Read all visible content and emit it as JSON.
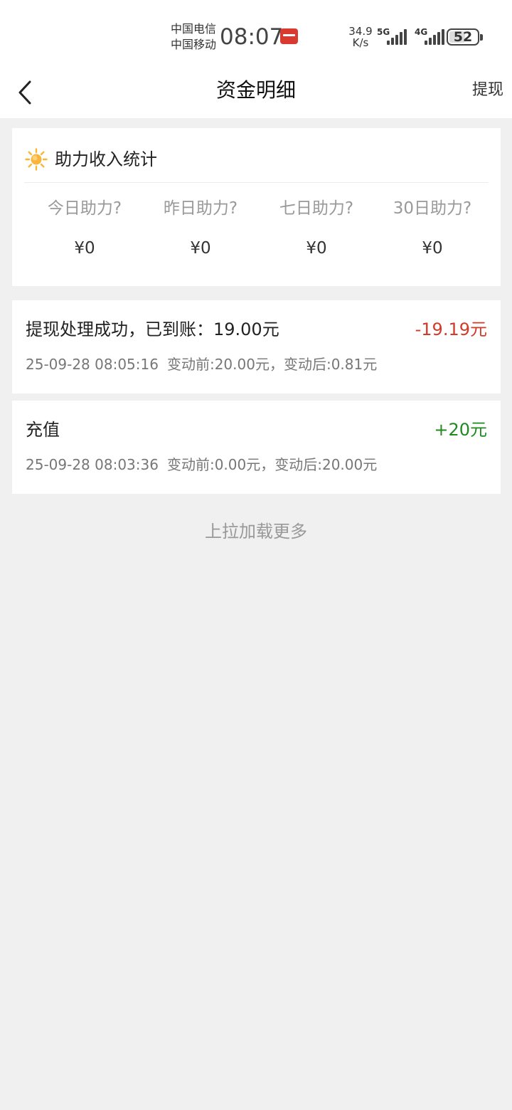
{
  "status_bar": {
    "carrier_1": "中国电信",
    "carrier_2": "中国移动",
    "time": "08:07",
    "net_speed_value": "34.9",
    "net_speed_unit": "K/s",
    "network_1": "5G",
    "network_2": "4G",
    "battery": "52"
  },
  "navbar": {
    "title": "资金明细",
    "action_label": "提现",
    "back_icon": "chevron-left-icon"
  },
  "stats": {
    "icon": "sun-icon",
    "title": "助力收入统计",
    "items": [
      {
        "label": "今日助力?",
        "value": "¥0"
      },
      {
        "label": "昨日助力?",
        "value": "¥0"
      },
      {
        "label": "七日助力?",
        "value": "¥0"
      },
      {
        "label": "30日助力?",
        "value": "¥0"
      }
    ]
  },
  "transactions": [
    {
      "title": "提现处理成功，已到账：19.00元",
      "amount": "-19.19元",
      "time": "25-09-28 08:05:16",
      "change": "变动前:20.00元，变动后:0.81元"
    },
    {
      "title": "充值",
      "amount": "+20元",
      "time": "25-09-28 08:03:36",
      "change": "变动前:0.00元，变动后:20.00元"
    }
  ],
  "load_more": "上拉加载更多",
  "colors": {
    "negative": "#d23a2a",
    "positive": "#1f8a1f",
    "background": "#f0f0f0"
  }
}
